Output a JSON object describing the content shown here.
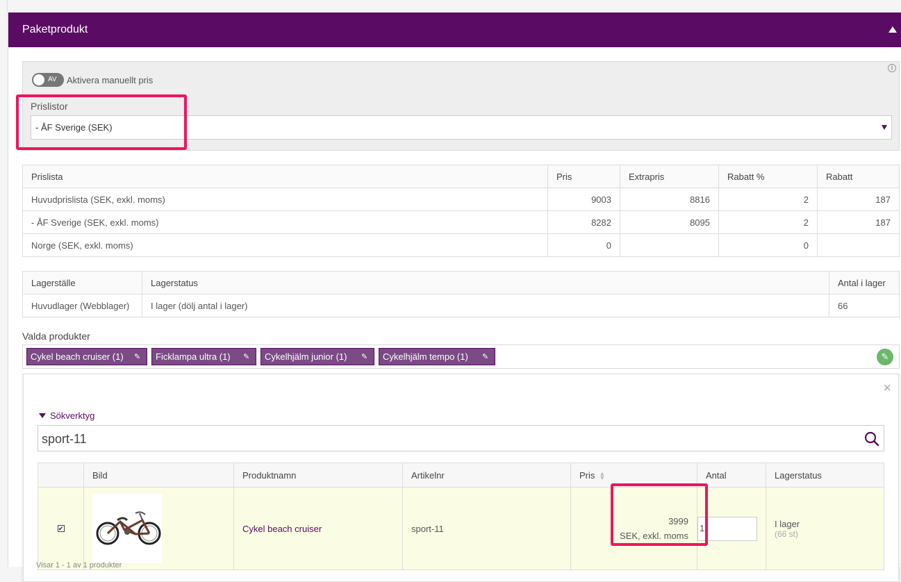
{
  "panel": {
    "title": "Paketprodukt"
  },
  "pricing": {
    "toggle_state": "AV",
    "toggle_label": "Aktivera manuellt pris",
    "info_glyph": "i",
    "prislistor_label": "Prislistor",
    "prislistor_value": "- ÅF Sverige (SEK)"
  },
  "price_table": {
    "headers": [
      "Prislista",
      "Pris",
      "Extrapris",
      "Rabatt %",
      "Rabatt"
    ],
    "rows": [
      [
        "Huvudprislista (SEK, exkl. moms)",
        "9003",
        "8816",
        "2",
        "187"
      ],
      [
        "- ÅF Sverige (SEK, exkl. moms)",
        "8282",
        "8095",
        "2",
        "187"
      ],
      [
        "Norge (SEK, exkl. moms)",
        "0",
        "",
        "0",
        ""
      ]
    ]
  },
  "stock_table": {
    "headers": [
      "Lagerställe",
      "Lagerstatus",
      "Antal i lager"
    ],
    "rows": [
      [
        "Huvudlager (Webblager)",
        "I lager (dölj antal i lager)",
        "66"
      ]
    ]
  },
  "selected": {
    "label": "Valda produkter",
    "tags": [
      "Cykel beach cruiser (1)",
      "Ficklampa ultra (1)",
      "Cykelhjälm junior (1)",
      "Cykelhjälm tempo (1)"
    ]
  },
  "search": {
    "tools_label": "Sökverktyg",
    "query": "sport-11",
    "close_glyph": "×"
  },
  "results": {
    "headers": [
      "",
      "Bild",
      "Produktnamn",
      "Artikelnr",
      "Pris",
      "Antal",
      "Lagerstatus"
    ],
    "rows": [
      {
        "checked": "✔",
        "name": "Cykel beach cruiser",
        "sku": "sport-11",
        "price": "3999",
        "price_unit": "SEK, exkl. moms",
        "qty": "1",
        "stock": "I lager",
        "stock_count": "(66 st)"
      }
    ],
    "footer_hint": "Visar 1 - 1 av 1 produkter"
  },
  "colors": {
    "brand": "#5a0b63",
    "highlight": "#f0145d",
    "row_highlight": "#fbfce4",
    "edit_green": "#6bb76b"
  }
}
